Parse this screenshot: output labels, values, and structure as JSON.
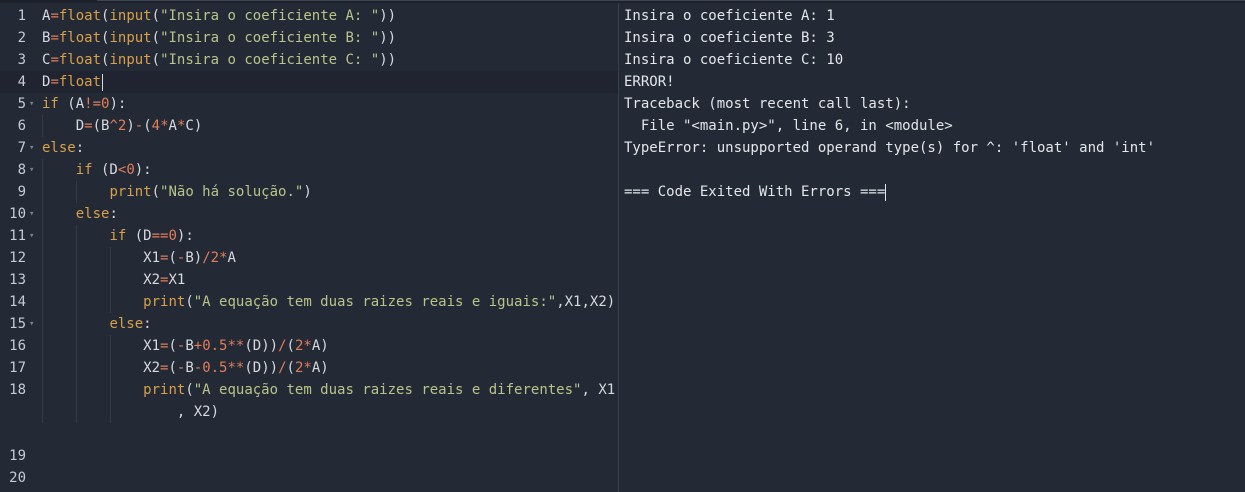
{
  "editor": {
    "lines": [
      {
        "no": "1",
        "fold": false,
        "tokens": [
          [
            "plain",
            "A"
          ],
          [
            "op",
            "="
          ],
          [
            "fn",
            "float"
          ],
          [
            "plain",
            "("
          ],
          [
            "fn",
            "input"
          ],
          [
            "plain",
            "("
          ],
          [
            "str",
            "\"Insira o coeficiente A: \""
          ],
          [
            "plain",
            "))"
          ]
        ]
      },
      {
        "no": "2",
        "fold": false,
        "tokens": [
          [
            "plain",
            "B"
          ],
          [
            "op",
            "="
          ],
          [
            "fn",
            "float"
          ],
          [
            "plain",
            "("
          ],
          [
            "fn",
            "input"
          ],
          [
            "plain",
            "("
          ],
          [
            "str",
            "\"Insira o coeficiente B: \""
          ],
          [
            "plain",
            "))"
          ]
        ]
      },
      {
        "no": "3",
        "fold": false,
        "tokens": [
          [
            "plain",
            "C"
          ],
          [
            "op",
            "="
          ],
          [
            "fn",
            "float"
          ],
          [
            "plain",
            "("
          ],
          [
            "fn",
            "input"
          ],
          [
            "plain",
            "("
          ],
          [
            "str",
            "\"Insira o coeficiente C: \""
          ],
          [
            "plain",
            "))"
          ]
        ]
      },
      {
        "no": "4",
        "fold": false,
        "active": true,
        "cursor": true,
        "tokens": [
          [
            "plain",
            "D"
          ],
          [
            "op",
            "="
          ],
          [
            "fn",
            "float"
          ]
        ]
      },
      {
        "no": "5",
        "fold": true,
        "tokens": [
          [
            "kw",
            "if"
          ],
          [
            "plain",
            " (A"
          ],
          [
            "op",
            "!="
          ],
          [
            "num",
            "0"
          ],
          [
            "plain",
            "):"
          ]
        ]
      },
      {
        "no": "6",
        "fold": false,
        "indent": 1,
        "tokens": [
          [
            "plain",
            "    D"
          ],
          [
            "op",
            "="
          ],
          [
            "plain",
            "(B"
          ],
          [
            "op",
            "^"
          ],
          [
            "num",
            "2"
          ],
          [
            "plain",
            ")"
          ],
          [
            "op",
            "-"
          ],
          [
            "plain",
            "("
          ],
          [
            "num",
            "4"
          ],
          [
            "op",
            "*"
          ],
          [
            "plain",
            "A"
          ],
          [
            "op",
            "*"
          ],
          [
            "plain",
            "C)"
          ]
        ]
      },
      {
        "no": "7",
        "fold": true,
        "tokens": [
          [
            "kw",
            "else"
          ],
          [
            "plain",
            ":"
          ]
        ]
      },
      {
        "no": "8",
        "fold": true,
        "indent": 1,
        "tokens": [
          [
            "plain",
            "    "
          ],
          [
            "kw",
            "if"
          ],
          [
            "plain",
            " (D"
          ],
          [
            "op",
            "<"
          ],
          [
            "num",
            "0"
          ],
          [
            "plain",
            "):"
          ]
        ]
      },
      {
        "no": "9",
        "fold": false,
        "indent": 2,
        "tokens": [
          [
            "plain",
            "        "
          ],
          [
            "fn",
            "print"
          ],
          [
            "plain",
            "("
          ],
          [
            "str",
            "\"Não há solução.\""
          ],
          [
            "plain",
            ")"
          ]
        ]
      },
      {
        "no": "10",
        "fold": true,
        "indent": 1,
        "tokens": [
          [
            "plain",
            "    "
          ],
          [
            "kw",
            "else"
          ],
          [
            "plain",
            ":"
          ]
        ]
      },
      {
        "no": "11",
        "fold": true,
        "indent": 2,
        "tokens": [
          [
            "plain",
            "        "
          ],
          [
            "kw",
            "if"
          ],
          [
            "plain",
            " (D"
          ],
          [
            "op",
            "=="
          ],
          [
            "num",
            "0"
          ],
          [
            "plain",
            "):"
          ]
        ]
      },
      {
        "no": "12",
        "fold": false,
        "indent": 3,
        "tokens": [
          [
            "plain",
            "            X1"
          ],
          [
            "op",
            "="
          ],
          [
            "plain",
            "("
          ],
          [
            "op",
            "-"
          ],
          [
            "plain",
            "B)"
          ],
          [
            "op",
            "/"
          ],
          [
            "num",
            "2"
          ],
          [
            "op",
            "*"
          ],
          [
            "plain",
            "A"
          ]
        ]
      },
      {
        "no": "13",
        "fold": false,
        "indent": 3,
        "tokens": [
          [
            "plain",
            "            X2"
          ],
          [
            "op",
            "="
          ],
          [
            "plain",
            "X1"
          ]
        ]
      },
      {
        "no": "14",
        "fold": false,
        "indent": 3,
        "tokens": [
          [
            "plain",
            "            "
          ],
          [
            "fn",
            "print"
          ],
          [
            "plain",
            "("
          ],
          [
            "str",
            "\"A equação tem duas raizes reais e iguais:\""
          ],
          [
            "plain",
            ",X1,X2)"
          ]
        ]
      },
      {
        "no": "15",
        "fold": true,
        "indent": 2,
        "tokens": [
          [
            "plain",
            "        "
          ],
          [
            "kw",
            "else"
          ],
          [
            "plain",
            ":"
          ]
        ]
      },
      {
        "no": "16",
        "fold": false,
        "indent": 3,
        "tokens": [
          [
            "plain",
            "            X1"
          ],
          [
            "op",
            "="
          ],
          [
            "plain",
            "("
          ],
          [
            "op",
            "-"
          ],
          [
            "plain",
            "B"
          ],
          [
            "op",
            "+"
          ],
          [
            "num",
            "0.5"
          ],
          [
            "op",
            "**"
          ],
          [
            "plain",
            "(D))"
          ],
          [
            "op",
            "/"
          ],
          [
            "plain",
            "("
          ],
          [
            "num",
            "2"
          ],
          [
            "op",
            "*"
          ],
          [
            "plain",
            "A)"
          ]
        ]
      },
      {
        "no": "17",
        "fold": false,
        "indent": 3,
        "tokens": [
          [
            "plain",
            "            X2"
          ],
          [
            "op",
            "="
          ],
          [
            "plain",
            "("
          ],
          [
            "op",
            "-"
          ],
          [
            "plain",
            "B"
          ],
          [
            "op",
            "-"
          ],
          [
            "num",
            "0.5"
          ],
          [
            "op",
            "**"
          ],
          [
            "plain",
            "(D))"
          ],
          [
            "op",
            "/"
          ],
          [
            "plain",
            "("
          ],
          [
            "num",
            "2"
          ],
          [
            "op",
            "*"
          ],
          [
            "plain",
            "A)"
          ]
        ]
      },
      {
        "no": "18",
        "fold": false,
        "indent": 3,
        "tokens": [
          [
            "plain",
            "            "
          ],
          [
            "fn",
            "print"
          ],
          [
            "plain",
            "("
          ],
          [
            "str",
            "\"A equação tem duas raizes reais e diferentes\""
          ],
          [
            "plain",
            ", X1"
          ]
        ]
      },
      {
        "no": "",
        "fold": false,
        "indent": 3,
        "tokens": [
          [
            "plain",
            "                , X2)"
          ]
        ]
      },
      {
        "no": "",
        "fold": false,
        "tokens": []
      },
      {
        "no": "19",
        "fold": false,
        "tokens": []
      },
      {
        "no": "20",
        "fold": false,
        "tokens": []
      }
    ]
  },
  "console": {
    "lines": [
      "Insira o coeficiente A: 1",
      "Insira o coeficiente B: 3",
      "Insira o coeficiente C: 10",
      "ERROR!",
      "Traceback (most recent call last):",
      "  File \"<main.py>\", line 6, in <module>",
      "TypeError: unsupported operand type(s) for ^: 'float' and 'int'",
      "",
      "=== Code Exited With Errors ==="
    ]
  },
  "icons": {
    "fold": "chevron-down-icon"
  }
}
